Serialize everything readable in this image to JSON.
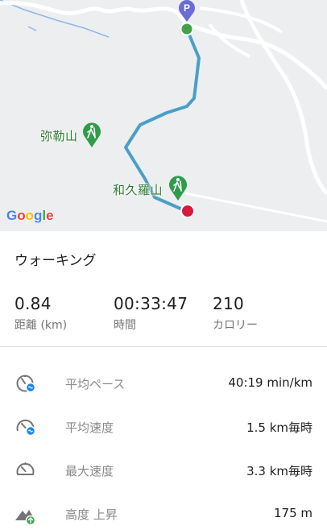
{
  "map": {
    "peaks": [
      {
        "name": "弥勒山",
        "icon": "hiker-icon"
      },
      {
        "name": "和久羅山",
        "icon": "hiker-icon"
      }
    ],
    "parking_marker": "P",
    "start_marker_color": "#43a047",
    "end_marker_color": "#d81b3c",
    "route_color": "#4a9fc6",
    "attribution": {
      "letters": [
        "G",
        "o",
        "o",
        "g",
        "l",
        "e"
      ]
    }
  },
  "activity_type": "ウォーキング",
  "stats": [
    {
      "value": "0.84",
      "label": "距離 (km)"
    },
    {
      "value": "00:33:47",
      "label": "時間"
    },
    {
      "value": "210",
      "label": "カロリー"
    }
  ],
  "metrics": [
    {
      "name": "平均ペース",
      "value": "40:19 min/km",
      "icon": "pace-icon"
    },
    {
      "name": "平均速度",
      "value": "1.5 km毎時",
      "icon": "speedometer-icon"
    },
    {
      "name": "最大速度",
      "value": "3.3 km毎時",
      "icon": "speedometer-icon"
    },
    {
      "name": "高度 上昇",
      "value": "175 m",
      "icon": "elevation-gain-icon"
    }
  ],
  "colors": {
    "accent": "#4a9fc6",
    "peak_green": "#2e7d32",
    "parking_purple": "#6a6bd6"
  }
}
